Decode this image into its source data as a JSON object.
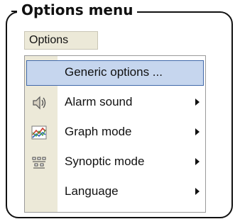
{
  "frame": {
    "title": "Options menu"
  },
  "menubar": {
    "label": "Options"
  },
  "menu": {
    "items": [
      {
        "label": "Generic options ...",
        "icon": "",
        "submenu": false,
        "highlighted": true
      },
      {
        "label": "Alarm sound",
        "icon": "speaker-icon",
        "submenu": true,
        "highlighted": false
      },
      {
        "label": "Graph mode",
        "icon": "graph-icon",
        "submenu": true,
        "highlighted": false
      },
      {
        "label": "Synoptic mode",
        "icon": "synoptic-icon",
        "submenu": true,
        "highlighted": false
      },
      {
        "label": "Language",
        "icon": "",
        "submenu": true,
        "highlighted": false
      }
    ]
  },
  "colors": {
    "highlight_fill": "#c6d6ee",
    "highlight_border": "#4169aa",
    "gutter": "#ece9d8"
  }
}
